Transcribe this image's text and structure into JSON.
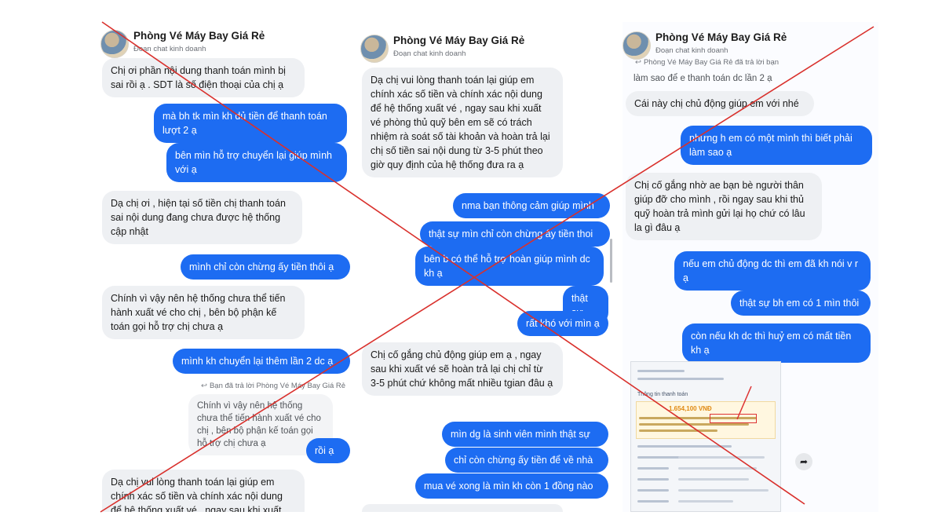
{
  "chat": {
    "title": "Phòng Vé Máy Bay Giá Rẻ",
    "subtitle": "Đoạn chat kinh doanh",
    "reply_note": "Bạn đã trả lời Phòng Vé Máy Bay Giá Rẻ",
    "reply_note_short": "Phòng Vé Máy Bay Giá Rẻ đã trả lời bạn"
  },
  "colors": {
    "outgoing_bubble": "#1d6cf2",
    "incoming_bubble": "#eef0f3",
    "cross_mark": "#d9302c"
  },
  "icons": [
    "avatar",
    "reply-arrow-icon",
    "share-icon",
    "scrollbar"
  ],
  "panel1": {
    "m1": "Chị ơi phần nội dung thanh toán mình bị sai rồi ạ . SDT là số điện thoại của chị ạ",
    "m2": "mà bh tk mìn kh dủ tiền để thanh toán lượt 2 ạ",
    "m3": "bên mìn hỗ trợ chuyển lại giúp mình với ạ",
    "m4": "Dạ chị ơi , hiện tại số tiền chị thanh toán sai nội dung đang chưa được hệ thống cập nhật",
    "m5": "mình chỉ còn chừng ấy tiền thôi ạ",
    "m6": "Chính vì vậy nên hệ thống chưa thể tiến hành xuất vé cho chị , bên bộ phận kế toán gọi hỗ trợ chị chưa ạ",
    "m7": "mình kh chuyển lại thêm lần 2 dc ạ",
    "quoted": "Chính vì vậy nên hệ thống chưa thể tiến hành xuất vé cho chị , bên bộ phận kế toán gọi hỗ trợ chị chưa ạ",
    "m8": "rồi ạ",
    "m9": "Dạ chị vui lòng thanh toán lại giúp em chính xác số tiền và chính xác nội dung để hệ thống xuất vé , ngay sau khi xuất"
  },
  "panel2": {
    "m1": "Dạ chị vui lòng thanh toán lại giúp em chính xác số tiền và chính xác nội dung để hệ thống xuất vé , ngay sau khi xuất vé phòng thủ quỹ bên em sẽ có trách nhiệm rà soát số tài khoản và hoàn trả lại chị số tiền sai nội dung từ 3-5 phút theo giờ quy định của hệ thống đưa ra ạ",
    "m2": "nma bạn thông cảm giúp mình",
    "m3": "thật sự mìn chỉ còn chừng ấy tiền thoi",
    "m4": "bên b có thể hỗ trợ hoàn giúp mình dc kh ạ",
    "m5": "thật sự",
    "m6": "rất khó với mìn ạ",
    "m7": "Chị cố gắng chủ động giúp em ạ , ngay sau khi xuất vé sẽ hoàn trả lại chị chỉ từ 3-5 phút chứ không mất nhiều tgian đâu ạ",
    "m8": "mìn dg là sinh viên mình thật sự",
    "m9": "chỉ còn chừng ấy tiền để về nhà",
    "m10": "mua vé xong là mìn kh còn 1 đồng nào"
  },
  "panel3": {
    "m0": "làm sao để e thanh toán dc lần 2 ạ",
    "m1": "Cái này chị chủ động giúp em với nhé",
    "m2": "nhưng h em có một mình thì biết phải làm sao ạ",
    "m3": "Chị cố gắng nhờ ae bạn bè người thân giúp đỡ cho mình , rồi ngay sau khi thủ quỹ hoàn trả mình gửi lại họ chứ có lâu la gì đâu ạ",
    "m4": "nếu em chủ động dc thì em đã kh nói v r ạ",
    "m5": "thật sự bh em có 1 mìn thôi",
    "m6": "còn nếu kh dc thì huỷ em có mất tiền kh ạ",
    "receipt_title": "Thông tin thanh toán",
    "receipt_amount": "1.654,100 VNĐ"
  }
}
